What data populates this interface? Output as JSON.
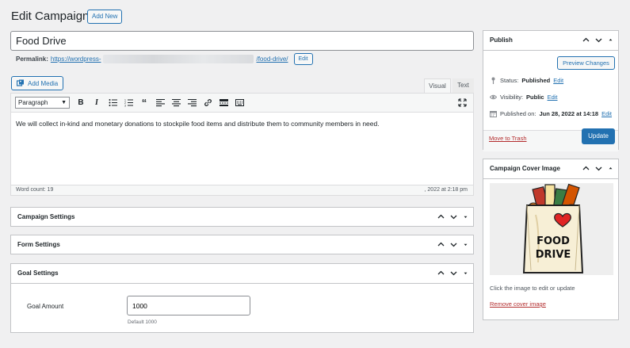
{
  "header": {
    "title": "Edit Campaign",
    "add_new": "Add New"
  },
  "post": {
    "title": "Food Drive",
    "permalink_label": "Permalink:",
    "permalink_prefix": "https://wordpress-",
    "permalink_slug": "/food-drive/",
    "permalink_edit": "Edit"
  },
  "editor": {
    "add_media": "Add Media",
    "tab_visual": "Visual",
    "tab_text": "Text",
    "format": "Paragraph",
    "content": "We will collect in-kind and monetary donations to stockpile food items and distribute them to community members in need.",
    "word_count": "Word count: 19",
    "last_edited": ", 2022 at 2:18 pm",
    "toolbar_icons": [
      "bold-icon",
      "italic-icon",
      "bullet-list-icon",
      "numbered-list-icon",
      "blockquote-icon",
      "align-left-icon",
      "align-center-icon",
      "align-right-icon",
      "link-icon",
      "more-tag-icon",
      "toolbar-toggle-icon",
      "fullscreen-icon"
    ]
  },
  "metaboxes": {
    "campaign_settings": "Campaign Settings",
    "form_settings": "Form Settings",
    "goal_settings": "Goal Settings",
    "goal_label": "Goal Amount",
    "goal_value": "1000",
    "goal_help": "Default 1000"
  },
  "publish": {
    "title": "Publish",
    "preview": "Preview Changes",
    "status_label": "Status:",
    "status_value": "Published",
    "visibility_label": "Visibility:",
    "visibility_value": "Public",
    "published_label": "Published on:",
    "published_value": "Jun 28, 2022 at 14:18",
    "edit": "Edit",
    "trash": "Move to Trash",
    "update": "Update"
  },
  "cover": {
    "title": "Campaign Cover Image",
    "caption": "Click the image to edit or update",
    "remove": "Remove cover image",
    "image_text_line1": "FOOD",
    "image_text_line2": "DRIVE"
  },
  "colors": {
    "accent": "#2271b1",
    "danger": "#b32d2e",
    "background": "#f0f0f1"
  }
}
